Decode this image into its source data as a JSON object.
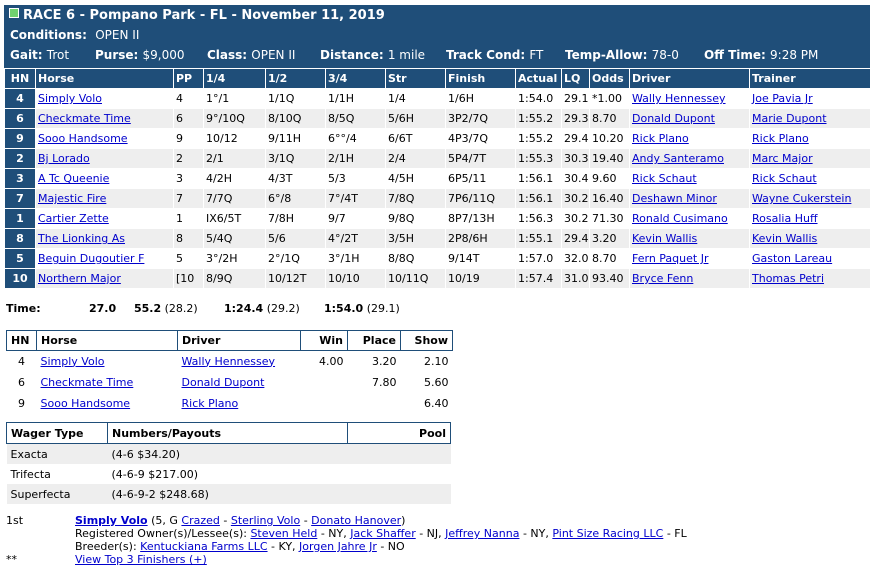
{
  "header": {
    "race_title": "RACE 6 - Pompano Park - FL - November 11, 2019",
    "conditions_label": "Conditions:",
    "conditions_value": "OPEN II",
    "gait_label": "Gait:",
    "gait_value": "Trot",
    "purse_label": "Purse:",
    "purse_value": "$9,000",
    "class_label": "Class:",
    "class_value": "OPEN II",
    "distance_label": "Distance:",
    "distance_value": "1 mile",
    "track_label": "Track Cond:",
    "track_value": "FT",
    "temp_label": "Temp-Allow:",
    "temp_value": "78-0",
    "off_label": "Off Time:",
    "off_value": "9:28 PM"
  },
  "results": {
    "columns": [
      "HN",
      "Horse",
      "PP",
      "1/4",
      "1/2",
      "3/4",
      "Str",
      "Finish",
      "Actual",
      "LQ",
      "Odds",
      "Driver",
      "Trainer"
    ],
    "rows": [
      {
        "hn": "4",
        "horse": "Simply Volo",
        "pp": "4",
        "q1": "1°/1",
        "q2": "1/1Q",
        "q3": "1/1H",
        "str": "1/4",
        "fin": "1/6H",
        "actual": "1:54.0",
        "lq": "29.1",
        "odds": "*1.00",
        "driver": "Wally Hennessey",
        "trainer": "Joe Pavia Jr"
      },
      {
        "hn": "6",
        "horse": "Checkmate Time",
        "pp": "6",
        "q1": "9°/10Q",
        "q2": "8/10Q",
        "q3": "8/5Q",
        "str": "5/6H",
        "fin": "3P2/7Q",
        "actual": "1:55.2",
        "lq": "29.3",
        "odds": "8.70",
        "driver": "Donald Dupont",
        "trainer": "Marie Dupont"
      },
      {
        "hn": "9",
        "horse": "Sooo Handsome",
        "pp": "9",
        "q1": "10/12",
        "q2": "9/11H",
        "q3": "6°°/4",
        "str": "6/6T",
        "fin": "4P3/7Q",
        "actual": "1:55.2",
        "lq": "29.4",
        "odds": "10.20",
        "driver": "Rick Plano",
        "trainer": "Rick Plano"
      },
      {
        "hn": "2",
        "horse": "Bj Lorado",
        "pp": "2",
        "q1": "2/1",
        "q2": "3/1Q",
        "q3": "2/1H",
        "str": "2/4",
        "fin": "5P4/7T",
        "actual": "1:55.3",
        "lq": "30.3",
        "odds": "19.40",
        "driver": "Andy Santeramo",
        "trainer": "Marc Major"
      },
      {
        "hn": "3",
        "horse": "A Tc Queenie",
        "pp": "3",
        "q1": "4/2H",
        "q2": "4/3T",
        "q3": "5/3",
        "str": "4/5H",
        "fin": "6P5/11",
        "actual": "1:56.1",
        "lq": "30.4",
        "odds": "9.60",
        "driver": "Rick Schaut",
        "trainer": "Rick Schaut"
      },
      {
        "hn": "7",
        "horse": "Majestic Fire",
        "pp": "7",
        "q1": "7/7Q",
        "q2": "6°/8",
        "q3": "7°/4T",
        "str": "7/8Q",
        "fin": "7P6/11Q",
        "actual": "1:56.1",
        "lq": "30.2",
        "odds": "16.40",
        "driver": "Deshawn Minor",
        "trainer": "Wayne Cukerstein"
      },
      {
        "hn": "1",
        "horse": "Cartier Zette",
        "pp": "1",
        "q1": "IX6/5T",
        "q2": "7/8H",
        "q3": "9/7",
        "str": "9/8Q",
        "fin": "8P7/13H",
        "actual": "1:56.3",
        "lq": "30.2",
        "odds": "71.30",
        "driver": "Ronald Cusimano",
        "trainer": "Rosalia Huff"
      },
      {
        "hn": "8",
        "horse": "The Lionking As",
        "pp": "8",
        "q1": "5/4Q",
        "q2": "5/6",
        "q3": "4°/2T",
        "str": "3/5H",
        "fin": "2P8/6H",
        "actual": "1:55.1",
        "lq": "29.4",
        "odds": "3.20",
        "driver": "Kevin Wallis",
        "trainer": "Kevin Wallis"
      },
      {
        "hn": "5",
        "horse": "Beguin Dugoutier F",
        "pp": "5",
        "q1": "3°/2H",
        "q2": "2°/1Q",
        "q3": "3°/1H",
        "str": "8/8Q",
        "fin": "9/14T",
        "actual": "1:57.0",
        "lq": "32.0",
        "odds": "8.70",
        "driver": "Fern Paquet Jr",
        "trainer": "Gaston Lareau"
      },
      {
        "hn": "10",
        "horse": "Northern Major",
        "pp": "[10",
        "q1": "8/9Q",
        "q2": "10/12T",
        "q3": "10/10",
        "str": "10/11Q",
        "fin": "10/19",
        "actual": "1:57.4",
        "lq": "31.0",
        "odds": "93.40",
        "driver": "Bryce Fenn",
        "trainer": "Thomas Petri"
      }
    ]
  },
  "times": {
    "label": "Time:",
    "q1": "27.0",
    "q2": "55.2",
    "q2_split": "(28.2)",
    "q3": "1:24.4",
    "q3_split": "(29.2)",
    "fin": "1:54.0",
    "fin_split": "(29.1)"
  },
  "payouts": {
    "columns": [
      "HN",
      "Horse",
      "Driver",
      "Win",
      "Place",
      "Show"
    ],
    "rows": [
      {
        "hn": "4",
        "horse": "Simply Volo",
        "driver": "Wally Hennessey",
        "win": "4.00",
        "place": "3.20",
        "show": "2.10"
      },
      {
        "hn": "6",
        "horse": "Checkmate Time",
        "driver": "Donald Dupont",
        "win": "",
        "place": "7.80",
        "show": "5.60"
      },
      {
        "hn": "9",
        "horse": "Sooo Handsome",
        "driver": "Rick Plano",
        "win": "",
        "place": "",
        "show": "6.40"
      }
    ]
  },
  "wagers": {
    "columns": [
      "Wager Type",
      "Numbers/Payouts",
      "Pool"
    ],
    "rows": [
      {
        "type": "Exacta",
        "payout": "(4-6 $34.20)",
        "pool": ""
      },
      {
        "type": "Trifecta",
        "payout": "(4-6-9 $217.00)",
        "pool": ""
      },
      {
        "type": "Superfecta",
        "payout": "(4-6-9-2 $248.68)",
        "pool": ""
      }
    ]
  },
  "winner": {
    "position": "1st",
    "horse": "Simply Volo",
    "age_sex": "(5, G",
    "sire": "Crazed",
    "dash1": " - ",
    "dam": "Sterling Volo",
    "dash2": " - ",
    "damsire": "Donato Hanover",
    "close": ")",
    "owners_label": "Registered Owner(s)/Lessee(s):",
    "owner1": "Steven Held",
    "owner1_loc": " - NY, ",
    "owner2": "Jack Shaffer",
    "owner2_loc": " - NJ, ",
    "owner3": "Jeffrey Nanna",
    "owner3_loc": " - NY, ",
    "owner4": "Pint Size Racing LLC",
    "owner4_loc": " - FL",
    "breeders_label": "Breeder(s):",
    "breeder1": "Kentuckiana Farms LLC",
    "breeder1_loc": " - KY, ",
    "breeder2": "Jorgen Jahre Jr",
    "breeder2_loc": " - NO",
    "stars": "**",
    "view_top3": "View Top 3 Finishers (+)"
  },
  "colors": {
    "header_bg": "#1f4e79",
    "stripe": "#eeeeee",
    "link": "#0000cc"
  }
}
